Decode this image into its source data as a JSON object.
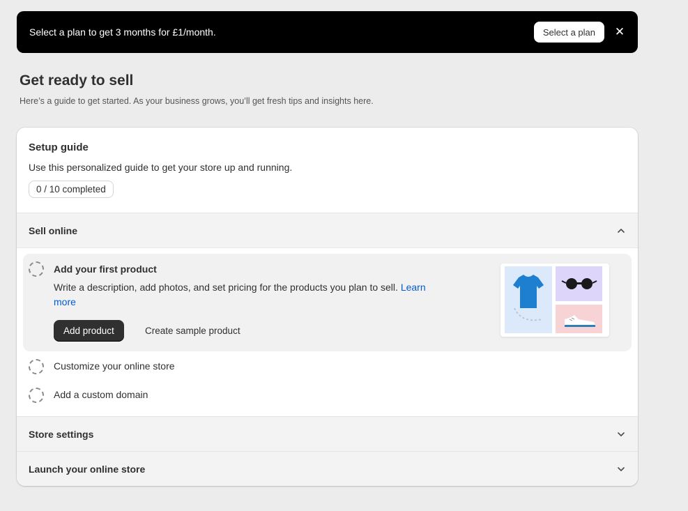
{
  "banner": {
    "text": "Select a plan to get 3 months for £1/month.",
    "button_label": "Select a plan",
    "close_icon": "✕"
  },
  "page": {
    "title": "Get ready to sell",
    "subtitle": "Here’s a guide to get started. As your business grows, you’ll get fresh tips and insights here."
  },
  "setup_guide": {
    "title": "Setup guide",
    "description": "Use this personalized guide to get your store up and running.",
    "progress": "0 / 10 completed",
    "completed": 0,
    "total": 10
  },
  "sections": {
    "sell_online": {
      "title": "Sell online",
      "expanded": true,
      "tasks": {
        "first_product": {
          "title": "Add your first product",
          "description": "Write a description, add photos, and set pricing for the products you plan to sell.",
          "learn_more": "Learn more",
          "primary_button": "Add product",
          "secondary_button": "Create sample product"
        },
        "customize_store": {
          "label": "Customize your online store"
        },
        "custom_domain": {
          "label": "Add a custom domain"
        }
      }
    },
    "store_settings": {
      "title": "Store settings",
      "expanded": false
    },
    "launch_store": {
      "title": "Launch your online store",
      "expanded": false
    }
  },
  "colors": {
    "banner_bg": "#000000",
    "link": "#005bd3",
    "primary_button": "#303030"
  }
}
